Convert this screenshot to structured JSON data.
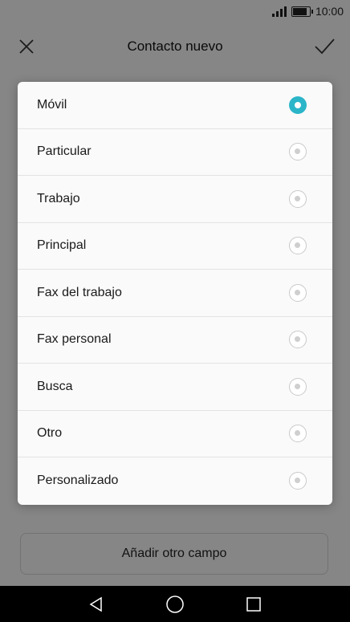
{
  "status": {
    "time": "10:00"
  },
  "appbar": {
    "title": "Contacto nuevo"
  },
  "dialog": {
    "options": [
      {
        "label": "Móvil",
        "selected": true
      },
      {
        "label": "Particular",
        "selected": false
      },
      {
        "label": "Trabajo",
        "selected": false
      },
      {
        "label": "Principal",
        "selected": false
      },
      {
        "label": "Fax del trabajo",
        "selected": false
      },
      {
        "label": "Fax personal",
        "selected": false
      },
      {
        "label": "Busca",
        "selected": false
      },
      {
        "label": "Otro",
        "selected": false
      },
      {
        "label": "Personalizado",
        "selected": false
      }
    ]
  },
  "add_field_label": "Añadir otro campo",
  "colors": {
    "accent": "#2bb5c9",
    "navbar": "#000000"
  },
  "icons": [
    "close-icon",
    "check-icon",
    "signal-icon",
    "battery-icon",
    "back-icon",
    "home-icon",
    "recents-icon"
  ]
}
